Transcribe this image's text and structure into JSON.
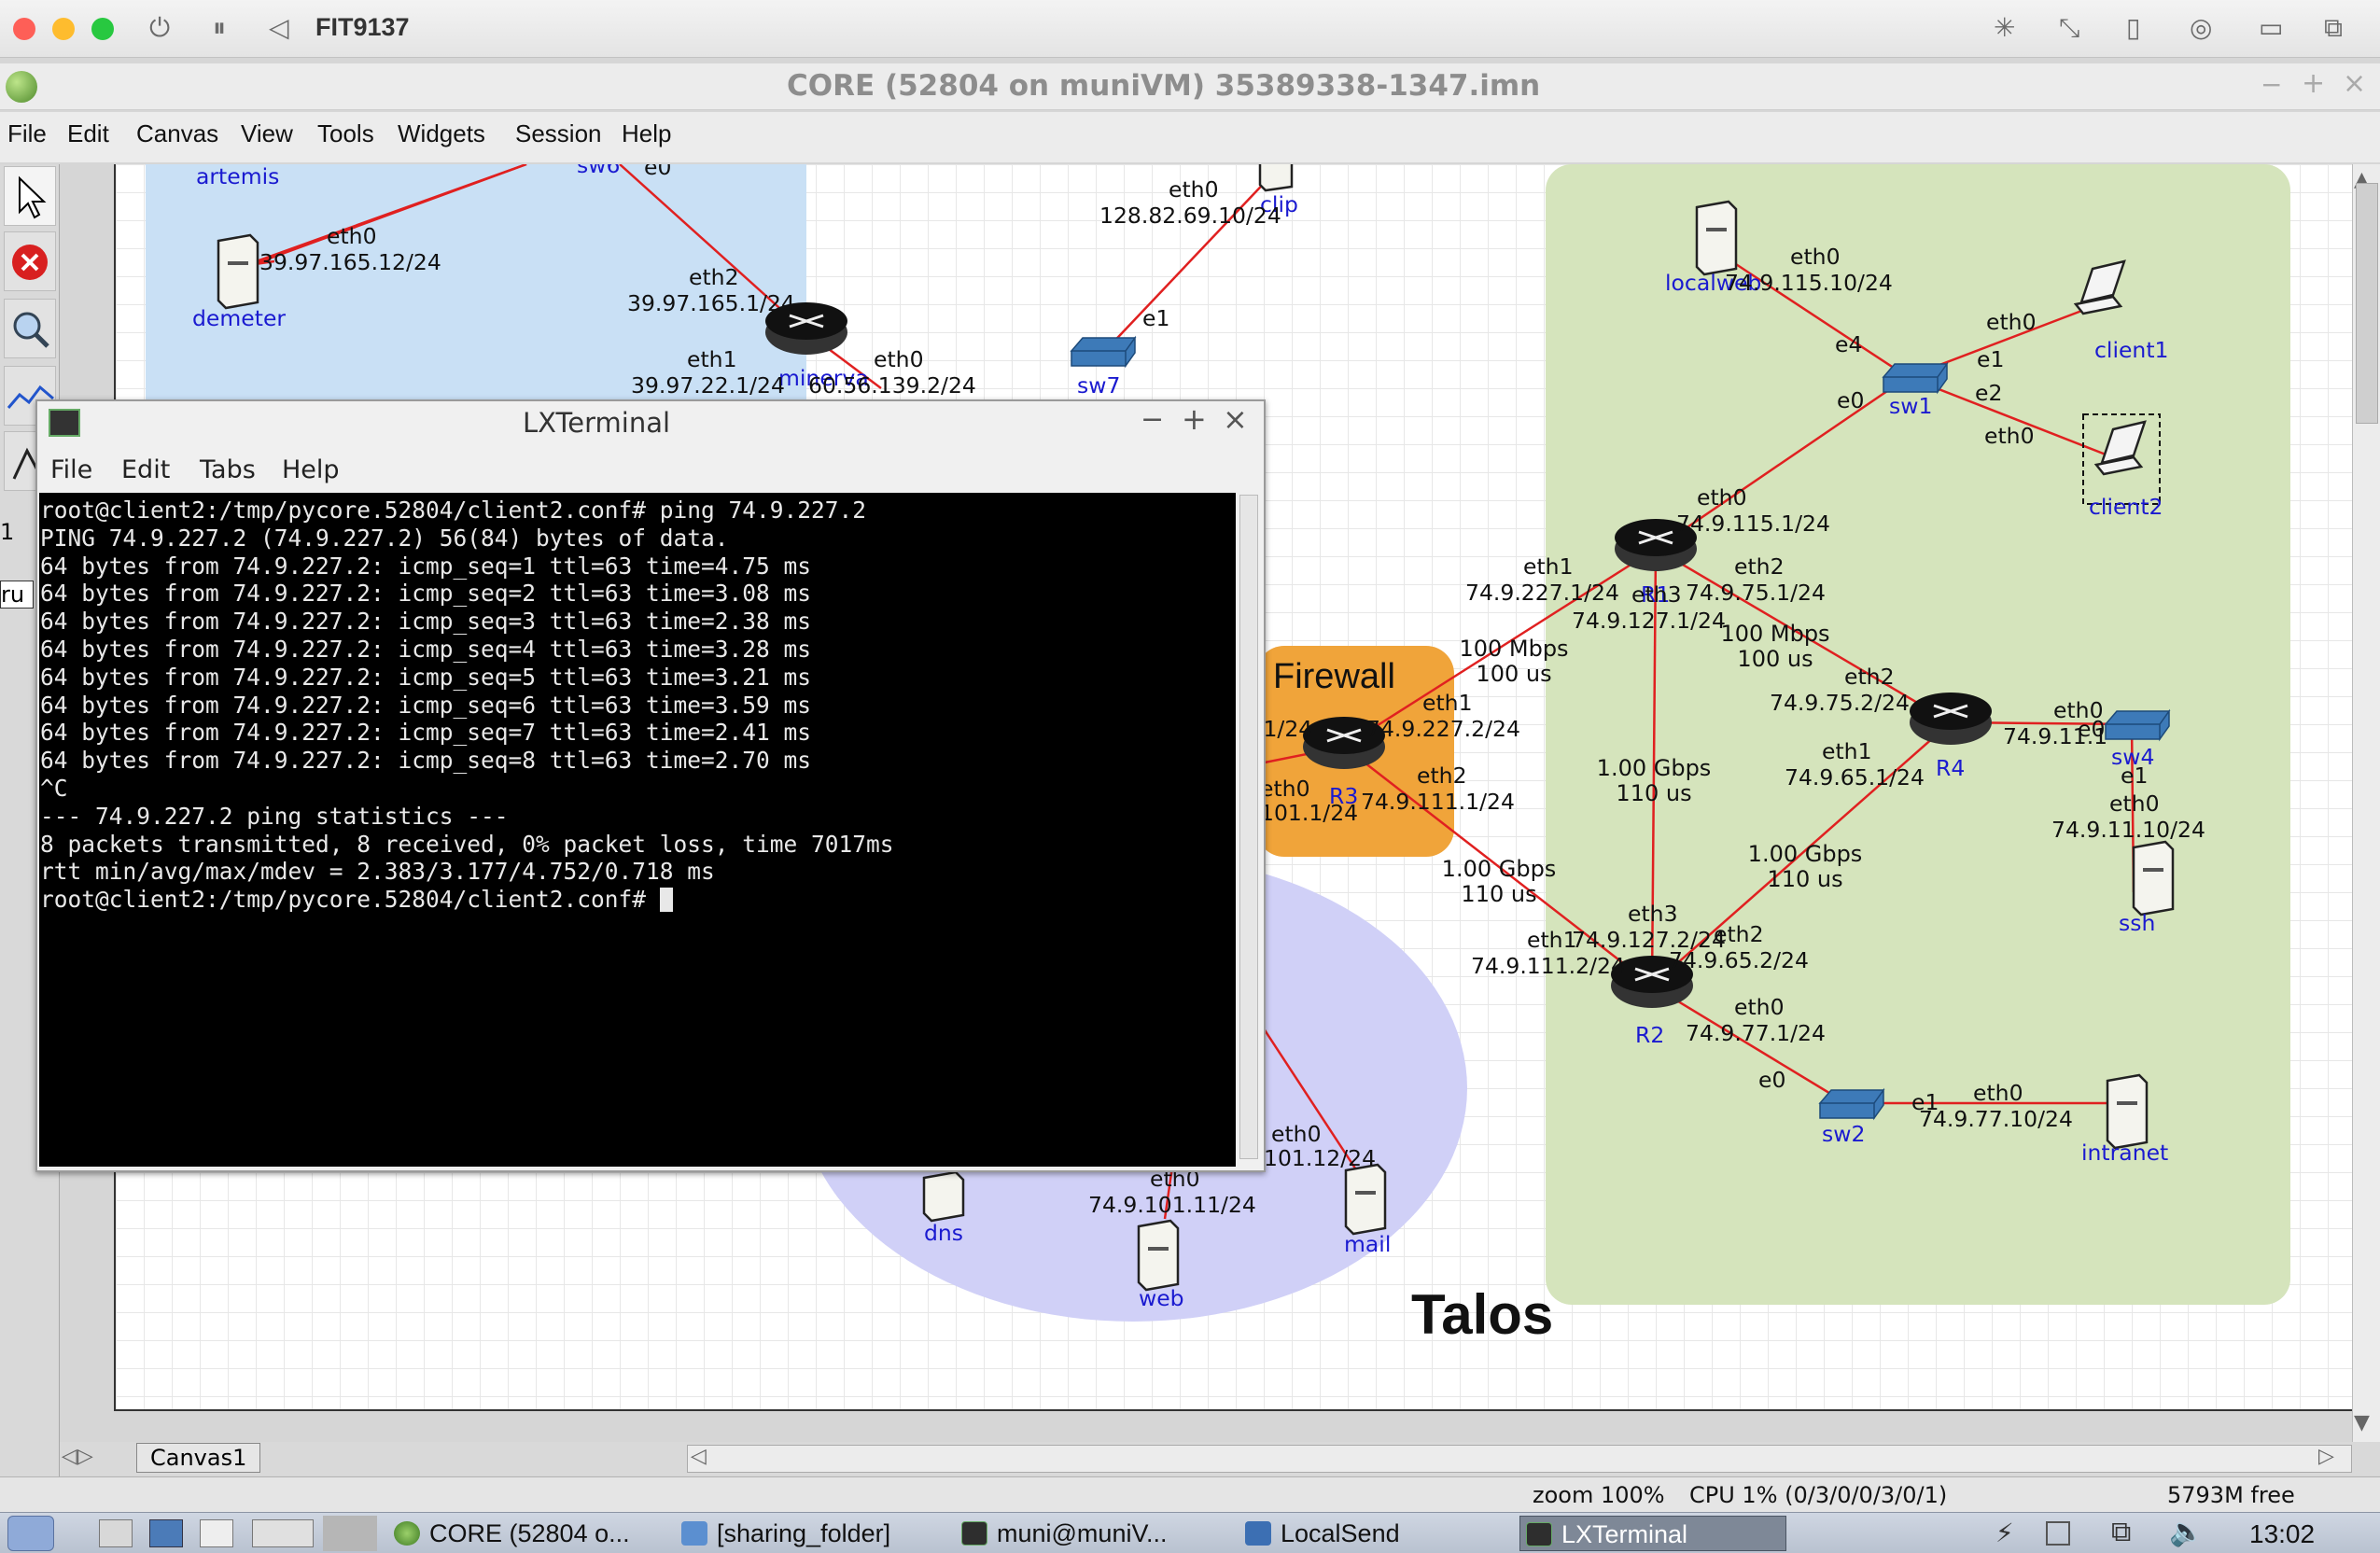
{
  "vm_window": {
    "title": "FIT9137"
  },
  "core_window": {
    "title": "CORE (52804 on muniVM) 35389338-1347.imn"
  },
  "menubar": [
    "File",
    "Edit",
    "Canvas",
    "View",
    "Tools",
    "Widgets",
    "Session",
    "Help"
  ],
  "canvas": {
    "regions": {
      "firewall_label": "Firewall",
      "talos_label": "Talos"
    },
    "tab": "Canvas1",
    "nodes": {
      "artemis": "artemis",
      "sw6": "sw6",
      "demeter": "demeter",
      "minerva": "minerva",
      "sw7": "sw7",
      "clip": "clip",
      "localweb": "localweb",
      "client1": "client1",
      "client2": "client2",
      "sw1": "sw1",
      "R1": "R1",
      "R3": "R3",
      "R4": "R4",
      "sw4": "sw4",
      "ssh": "ssh",
      "R2": "R2",
      "sw2": "sw2",
      "intranet": "intranet",
      "dns": "dns",
      "web": "web",
      "mail": "mail"
    },
    "labels": {
      "artemis_e0": "e0",
      "demeter_eth0": "eth0",
      "demeter_ip": "39.97.165.12/24",
      "minerva_eth2": "eth2",
      "minerva_eth2_ip": "39.97.165.1/24",
      "minerva_eth1": "eth1",
      "minerva_eth1_ip": "39.97.22.1/24",
      "minerva_eth0": "eth0",
      "minerva_eth0_ip": "60.56.139.2/24",
      "clip_eth0": "eth0",
      "clip_ip": "128.82.69.10/24",
      "sw7_e1": "e1",
      "localweb_eth0": "eth0",
      "localweb_ip": "74.9.115.10/24",
      "sw1_e4": "e4",
      "sw1_e0": "e0",
      "sw1_e1": "e1",
      "sw1_e2": "e2",
      "client1_eth0": "eth0",
      "client2_eth0": "eth0",
      "R1_eth0": "eth0",
      "R1_eth0_ip": "74.9.115.1/24",
      "R1_eth1": "eth1",
      "R1_eth1_ip": "74.9.227.1/24",
      "R1_eth3": "eth3",
      "R1_eth3_ip": "74.9.127.1/24",
      "R1_eth2": "eth2",
      "R1_eth2_ip": "74.9.75.1/24",
      "link_R1_R3": "100 Mbps\n100 us",
      "link_R1_R4": "100 Mbps\n100 us",
      "R3_eth1": "eth1",
      "R3_eth1_ip": "74.9.227.2/24",
      "R3_eth2": "eth2",
      "R3_eth2_ip": "74.9.111.1/24",
      "R3_left_ip": ".1/24",
      "R3_eth0": "eth0",
      "R3_eth0_ip": "101.1/24",
      "R4_eth2": "eth2",
      "R4_eth2_ip": "74.9.75.2/24",
      "R4_eth1": "eth1",
      "R4_eth1_ip": "74.9.65.1/24",
      "R4_eth0": "eth0",
      "R4_eth0_ip": "74.9.11.1",
      "sw4_e0": "e0",
      "sw4_e1": "e1",
      "ssh_eth0": "eth0",
      "ssh_ip": "74.9.11.10/24",
      "link_R1_R2": "1.00 Gbps\n110 us",
      "link_R3_R2": "1.00 Gbps\n110 us",
      "link_R4_R2": "1.00 Gbps\n110 us",
      "R2_eth3": "eth3",
      "R2_eth3_ip": "74.9.127.2/24",
      "R2_eth1": "eth1",
      "R2_eth1_ip": "74.9.111.2/24",
      "R2_eth2": "eth2",
      "R2_eth2_ip": "74.9.65.2/24",
      "R2_eth0": "eth0",
      "R2_eth0_ip": "74.9.77.1/24",
      "sw2_e0": "e0",
      "sw2_e1": "e1",
      "intranet_eth0": "eth0",
      "intranet_ip": "74.9.77.10/24",
      "mail_eth0": "eth0",
      "mail_ip": "101.12/24",
      "web_eth0": "eth0",
      "web_ip": "74.9.101.11/24"
    }
  },
  "terminal": {
    "title": "LXTerminal",
    "menu": [
      "File",
      "Edit",
      "Tabs",
      "Help"
    ],
    "lines": [
      "root@client2:/tmp/pycore.52804/client2.conf# ping 74.9.227.2",
      "PING 74.9.227.2 (74.9.227.2) 56(84) bytes of data.",
      "64 bytes from 74.9.227.2: icmp_seq=1 ttl=63 time=4.75 ms",
      "64 bytes from 74.9.227.2: icmp_seq=2 ttl=63 time=3.08 ms",
      "64 bytes from 74.9.227.2: icmp_seq=3 ttl=63 time=2.38 ms",
      "64 bytes from 74.9.227.2: icmp_seq=4 ttl=63 time=3.28 ms",
      "64 bytes from 74.9.227.2: icmp_seq=5 ttl=63 time=3.21 ms",
      "64 bytes from 74.9.227.2: icmp_seq=6 ttl=63 time=3.59 ms",
      "64 bytes from 74.9.227.2: icmp_seq=7 ttl=63 time=2.41 ms",
      "64 bytes from 74.9.227.2: icmp_seq=8 ttl=63 time=2.70 ms",
      "^C",
      "--- 74.9.227.2 ping statistics ---",
      "8 packets transmitted, 8 received, 0% packet loss, time 7017ms",
      "rtt min/avg/max/mdev = 2.383/3.177/4.752/0.718 ms",
      "root@client2:/tmp/pycore.52804/client2.conf# "
    ]
  },
  "statusbar": {
    "zoom": "zoom 100%",
    "cpu": "CPU 1% (0/3/0/0/3/0/1)",
    "mem": "5793M free"
  },
  "taskbar": {
    "items": [
      "CORE (52804 o...",
      "[sharing_folder]",
      "muni@muniV...",
      "LocalSend",
      "LXTerminal"
    ],
    "clock": "13:02"
  },
  "left_stub": {
    "digit": "1",
    "text": "ru"
  },
  "colors": {
    "blue_region": "#c9e0f5",
    "green_region": "#d5e4bc",
    "firewall": "#f0a43a",
    "dmz": "#d0d0f7",
    "link": "#e02020"
  },
  "icons": [
    "power-icon",
    "pause-icon",
    "back-icon",
    "select-icon",
    "stop-icon",
    "zoom-icon",
    "router-icon",
    "switch-icon",
    "server-icon",
    "laptop-icon"
  ]
}
